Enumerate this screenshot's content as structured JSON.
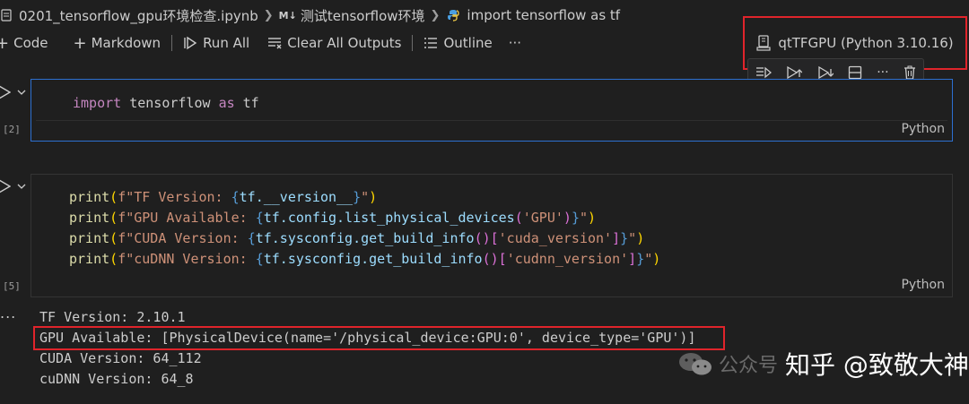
{
  "breadcrumb": {
    "file": "0201_tensorflow_gpu环境检查.ipynb",
    "section_badge": "M↓",
    "section": "测试tensorflow环境",
    "cell": "import tensorflow as tf"
  },
  "toolbar": {
    "code": "Code",
    "markdown": "Markdown",
    "run_all": "Run All",
    "clear_outputs": "Clear All Outputs",
    "outline": "Outline",
    "more": "···"
  },
  "kernel": {
    "label": "qtTFGPU (Python 3.10.16)"
  },
  "cell_toolbar": {
    "more": "···"
  },
  "cells": [
    {
      "exec_count": "[2]",
      "language": "Python",
      "code": {
        "kw": "import",
        "mod": "tensorflow",
        "as": "as",
        "alias": "tf"
      }
    },
    {
      "exec_count": "[5]",
      "language": "Python",
      "lines": [
        {
          "fn": "print",
          "p1": "(",
          "pre": "f\"TF Version: ",
          "ob": "{",
          "expr": "tf.__version__",
          "cb": "}",
          "post": "\"",
          "p2": ")"
        },
        {
          "fn": "print",
          "p1": "(",
          "pre": "f\"GPU Available: ",
          "ob": "{",
          "expr": "tf.config.list_physical_devices",
          "ip1": "(",
          "arg": "'GPU'",
          "ip2": ")",
          "cb": "}",
          "post": "\"",
          "p2": ")"
        },
        {
          "fn": "print",
          "p1": "(",
          "pre": "f\"CUDA Version: ",
          "ob": "{",
          "expr": "tf.sysconfig.get_build_info",
          "ip1": "()",
          "ib1": "[",
          "arg": "'cuda_version'",
          "ib2": "]",
          "cb": "}",
          "post": "\"",
          "p2": ")"
        },
        {
          "fn": "print",
          "p1": "(",
          "pre": "f\"cuDNN Version: ",
          "ob": "{",
          "expr": "tf.sysconfig.get_build_info",
          "ip1": "()",
          "ib1": "[",
          "arg": "'cudnn_version'",
          "ib2": "]",
          "cb": "}",
          "post": "\"",
          "p2": ")"
        }
      ]
    }
  ],
  "output": {
    "dots": "...",
    "lines": [
      "TF Version: 2.10.1",
      "GPU Available: [PhysicalDevice(name='/physical_device:GPU:0', device_type='GPU')]",
      "CUDA Version: 64_112",
      "cuDNN Version: 64_8"
    ]
  },
  "watermark": {
    "faint": "公众号",
    "text": "知乎 @致敬大神"
  },
  "colors": {
    "accent_border": "#2d6fd0",
    "highlight_red": "#e0242b"
  }
}
